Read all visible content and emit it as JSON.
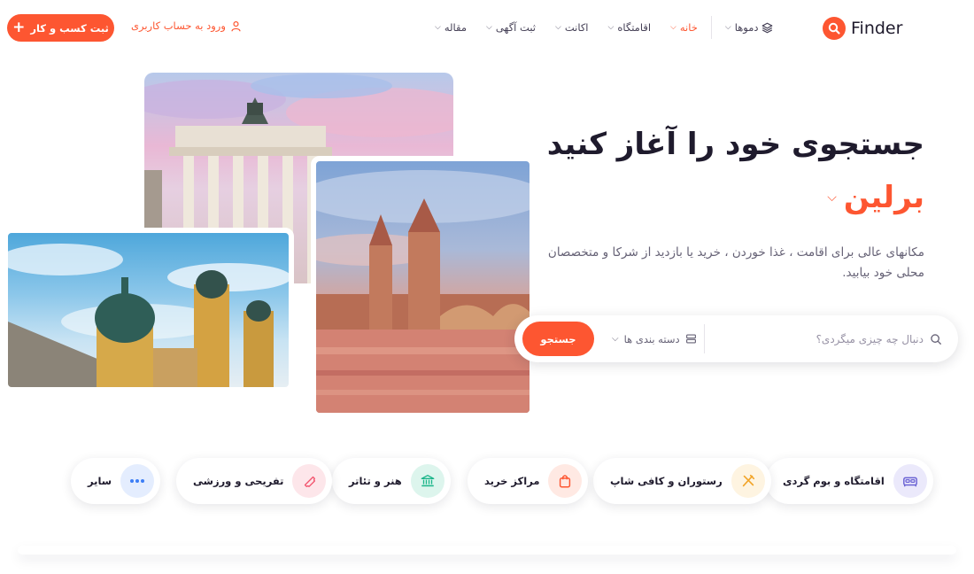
{
  "header": {
    "logo_text": "Finder",
    "add_business_label": "ثبت کسب و کار",
    "login_label": "ورود به حساب کاربری",
    "nav": [
      {
        "label": "دموها",
        "icon": "layers-icon"
      },
      {
        "label": "خانه",
        "active": true
      },
      {
        "label": "اقامتگاه"
      },
      {
        "label": "اکانت"
      },
      {
        "label": "ثبت آگهی"
      },
      {
        "label": "مقاله"
      }
    ]
  },
  "hero": {
    "title": "جستجوی خود را آغاز کنید",
    "city": "برلین",
    "description": "مکانهای عالی برای اقامت ، غذا خوردن ، خرید یا بازدید از شرکا و متخصصان محلی خود بیابید."
  },
  "search": {
    "placeholder": "دنبال چه چیزی میگردی؟",
    "category_label": "دسته بندی ها",
    "button_label": "جستجو"
  },
  "categories": [
    {
      "label": "اقامتگاه و بوم گردی",
      "icon": "bed-icon",
      "color": "#6b63d4",
      "bg": "#ebe9fb"
    },
    {
      "label": "رستوران و کافی شاپ",
      "icon": "utensils-icon",
      "color": "#f2a52a",
      "bg": "#fef4e1"
    },
    {
      "label": "مراکز خرید",
      "icon": "shopping-bag-icon",
      "color": "#fd5631",
      "bg": "#ffe9e3"
    },
    {
      "label": "هنر و تئاتر",
      "icon": "museum-icon",
      "color": "#1bb58a",
      "bg": "#ddf5ed"
    },
    {
      "label": "تفریحی و ورزشی",
      "icon": "ticket-icon",
      "color": "#f2546e",
      "bg": "#fde6ea"
    },
    {
      "label": "سایر",
      "icon": "more-dots-icon",
      "color": "#3d7ef6",
      "bg": "#e4edfe"
    }
  ],
  "colors": {
    "accent": "#fd5631",
    "text_dark": "#1f1b2d",
    "text_muted": "#666276"
  }
}
